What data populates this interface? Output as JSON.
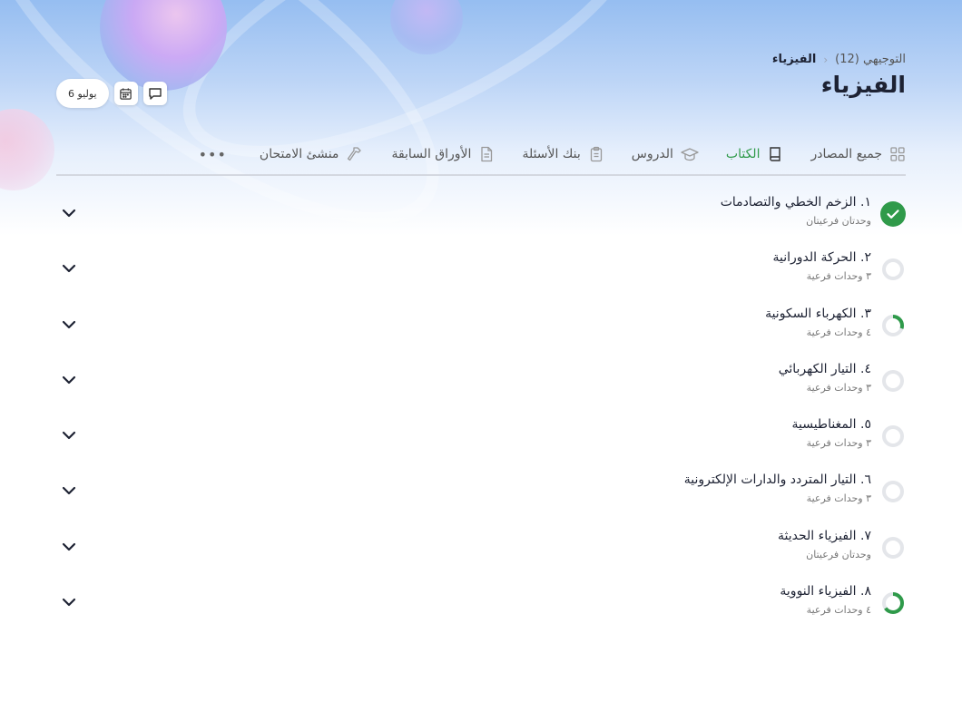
{
  "header": {
    "breadcrumb_parent": "التوجيهي (12)",
    "breadcrumb_current": "الفيزياء",
    "title": "الفيزياء"
  },
  "top_actions": {
    "date_label": "6 يوليو",
    "calendar_icon": "calendar-icon",
    "chat_icon": "chat-icon"
  },
  "tabs": [
    {
      "label": "جميع المصادر",
      "icon": "grid-icon",
      "active": false
    },
    {
      "label": "الكتاب",
      "icon": "book-icon",
      "active": true
    },
    {
      "label": "الدروس",
      "icon": "graduation-cap-icon",
      "active": false
    },
    {
      "label": "بنك الأسئلة",
      "icon": "clipboard-icon",
      "active": false
    },
    {
      "label": "الأوراق السابقة",
      "icon": "document-icon",
      "active": false
    },
    {
      "label": "منشئ الامتحان",
      "icon": "hammer-icon",
      "active": false
    }
  ],
  "colors": {
    "accent": "#2f9a4a",
    "ring_empty": "#e4e6ea"
  },
  "chapters": [
    {
      "title": "١. الزخم الخطي والتصادمات",
      "subtitle": "وحدتان فرعيتان",
      "progress": 1.0
    },
    {
      "title": "٢. الحركة الدورانية",
      "subtitle": "٣ وحدات فرعية",
      "progress": 0.0
    },
    {
      "title": "٣. الكهرباء السكونية",
      "subtitle": "٤ وحدات فرعية",
      "progress": 0.3
    },
    {
      "title": "٤. التيار الكهربائي",
      "subtitle": "٣ وحدات فرعية",
      "progress": 0.0
    },
    {
      "title": "٥. المغناطيسية",
      "subtitle": "٣ وحدات فرعية",
      "progress": 0.0
    },
    {
      "title": "٦. التيار المتردد والدارات الإلكترونية",
      "subtitle": "٣ وحدات فرعية",
      "progress": 0.0
    },
    {
      "title": "٧. الفيزياء الحديثة",
      "subtitle": "وحدتان فرعيتان",
      "progress": 0.0
    },
    {
      "title": "٨. الفيزياء النووية",
      "subtitle": "٤ وحدات فرعية",
      "progress": 0.65
    }
  ]
}
